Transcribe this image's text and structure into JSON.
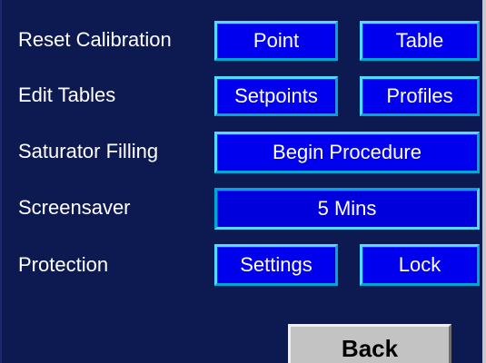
{
  "rows": [
    {
      "label": "Reset Calibration",
      "buttons": [
        "Point",
        "Table"
      ]
    },
    {
      "label": "Edit Tables",
      "buttons": [
        "Setpoints",
        "Profiles"
      ]
    },
    {
      "label": "Saturator Filling",
      "buttons": [
        "Begin Procedure"
      ]
    },
    {
      "label": "Screensaver",
      "buttons": [
        "5 Mins"
      ]
    },
    {
      "label": "Protection",
      "buttons": [
        "Settings",
        "Lock"
      ]
    }
  ],
  "back_label": "Back",
  "colors": {
    "background": "#0d1a52",
    "button": "#0000ee",
    "button_highlight": "#57d8ff",
    "back_button": "#c3c3c3"
  }
}
